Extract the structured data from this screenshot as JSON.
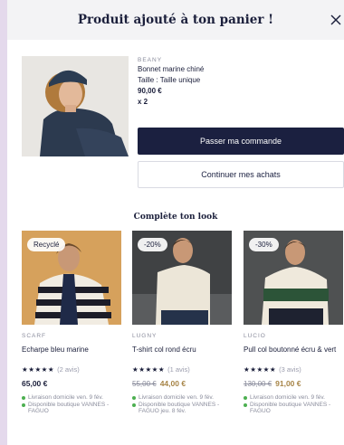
{
  "modal": {
    "title": "Produit ajouté à ton panier !",
    "close_icon": "close-icon"
  },
  "product": {
    "brand": "BEANY",
    "name": "Bonnet marine chiné",
    "size": "Taille : Taille unique",
    "price": "90,00 €",
    "qty": "x 2",
    "checkout_label": "Passer ma commande",
    "continue_label": "Continuer mes achats"
  },
  "look": {
    "title": "Complète ton look",
    "cards": [
      {
        "badge": "Recyclé",
        "brand": "SCARF",
        "name": "Echarpe bleu marine",
        "stars": "★★★★★",
        "reviews": "(2 avis)",
        "price": "65,00 €",
        "old_price": "",
        "avail1": "Livraison domicile ven. 9 fév.",
        "avail2": "Disponible boutique VANNES - FAGUO"
      },
      {
        "badge": "-20%",
        "brand": "LUGNY",
        "name": "T-shirt col rond écru",
        "stars": "★★★★★",
        "reviews": "(1 avis)",
        "old_price": "55,00 €",
        "price": "44,00 €",
        "avail1": "Livraison domicile ven. 9 fév.",
        "avail2": "Disponible boutique VANNES - FAGUO jeu. 8 fév."
      },
      {
        "badge": "-30%",
        "brand": "LUCIO",
        "name": "Pull col boutonné écru & vert",
        "stars": "★★★★★",
        "reviews": "(3 avis)",
        "old_price": "130,00 €",
        "price": "91,00 €",
        "avail1": "Livraison domicile ven. 9 fév.",
        "avail2": "Disponible boutique VANNES - FAGUO"
      }
    ]
  },
  "colors": {
    "navy": "#1b2040",
    "sale": "#a78548",
    "available": "#4caf50",
    "backdrop": "#e4d9ec"
  }
}
